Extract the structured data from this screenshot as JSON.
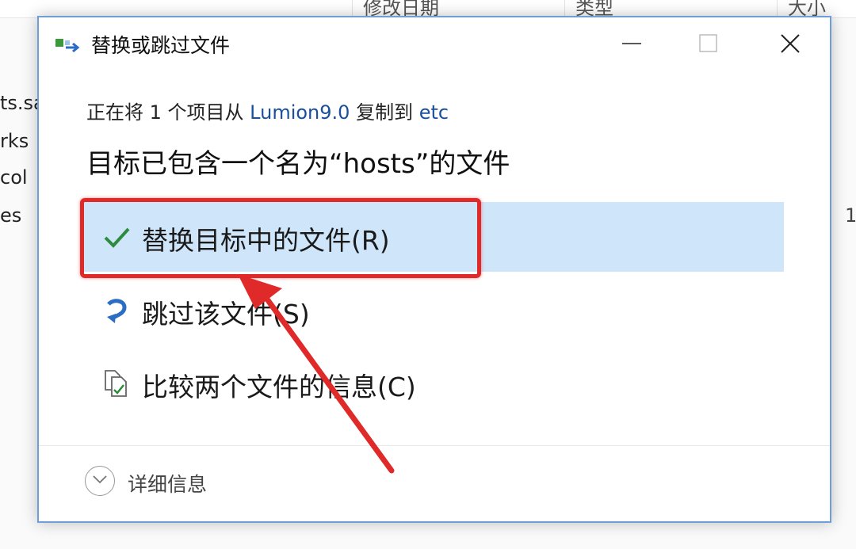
{
  "background": {
    "columns": [
      "修改日期",
      "类型",
      "大小"
    ],
    "files": [
      "ts.sa",
      "rks",
      "col",
      "es"
    ],
    "right_value": "1"
  },
  "dialog": {
    "title": "替换或跳过文件",
    "copy_prefix": "正在将 1 个项目从 ",
    "source": "Lumion9.0",
    "copy_mid": " 复制到 ",
    "destination": "etc",
    "heading": "目标已包含一个名为“hosts”的文件",
    "options": {
      "replace": "替换目标中的文件(R)",
      "skip": "跳过该文件(S)",
      "compare": "比较两个文件的信息(C)"
    },
    "details": "详细信息"
  },
  "colors": {
    "selected_bg": "#cfe6fa",
    "annotation": "#e02a2a",
    "check": "#2e8b3d",
    "link": "#1a4f9c"
  },
  "icons": [
    "move-file-icon",
    "minimize-icon",
    "maximize-icon",
    "close-icon",
    "checkmark-icon",
    "skip-icon",
    "compare-icon",
    "chevron-down-icon"
  ]
}
